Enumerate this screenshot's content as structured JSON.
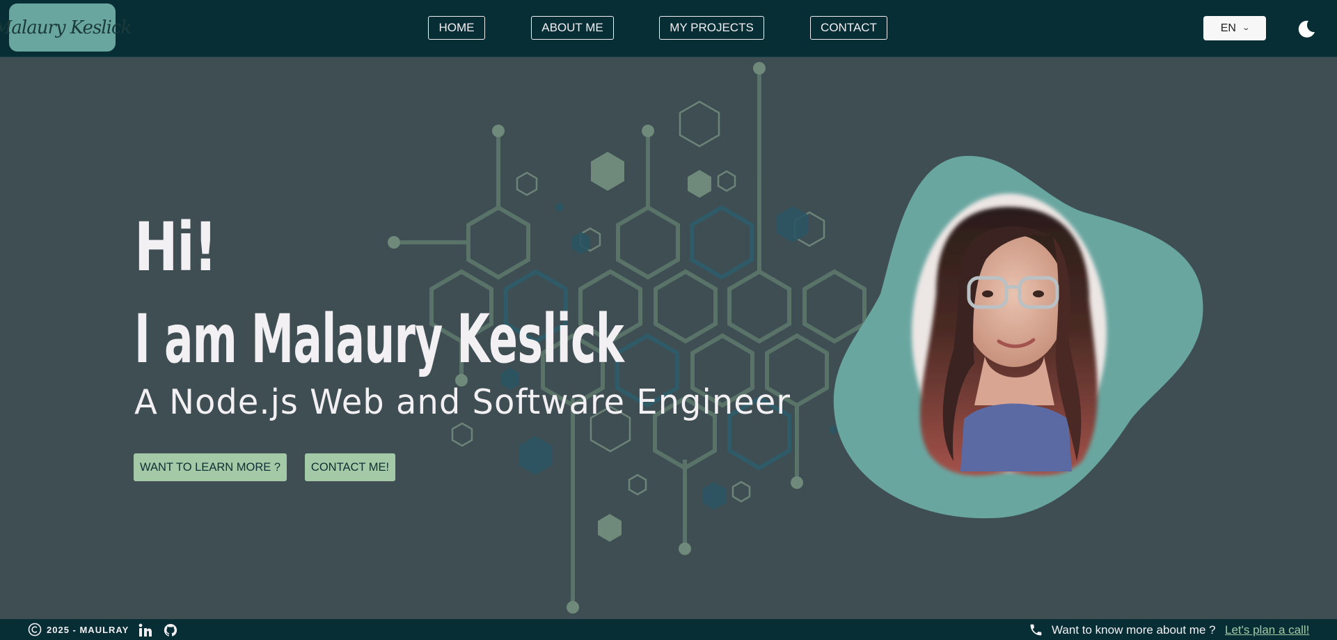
{
  "header": {
    "logo_text": "Malaury Keslick",
    "nav": [
      {
        "label": "HOME"
      },
      {
        "label": "ABOUT ME"
      },
      {
        "label": "MY PROJECTS"
      },
      {
        "label": "CONTACT"
      }
    ],
    "language": "EN",
    "theme_icon": "moon-icon"
  },
  "hero": {
    "greeting": "Hi!",
    "name_line": "I am Malaury Keslick",
    "subtitle": "A Node.js Web and Software Engineer",
    "buttons": [
      {
        "label": "WANT TO LEARN MORE ?"
      },
      {
        "label": "CONTACT ME!"
      }
    ],
    "portrait_icon": "profile-photo"
  },
  "footer": {
    "copyright": "2025 - MAULRAY",
    "social": [
      {
        "icon": "linkedin-icon"
      },
      {
        "icon": "github-icon"
      }
    ],
    "call_prompt": "Want to know more about me ?",
    "call_link": "Let's plan a call!"
  },
  "colors": {
    "header_bg": "#072e35",
    "page_bg": "#3e4e52",
    "accent": "#a3c9a6",
    "blob": "#6aa6a0"
  }
}
